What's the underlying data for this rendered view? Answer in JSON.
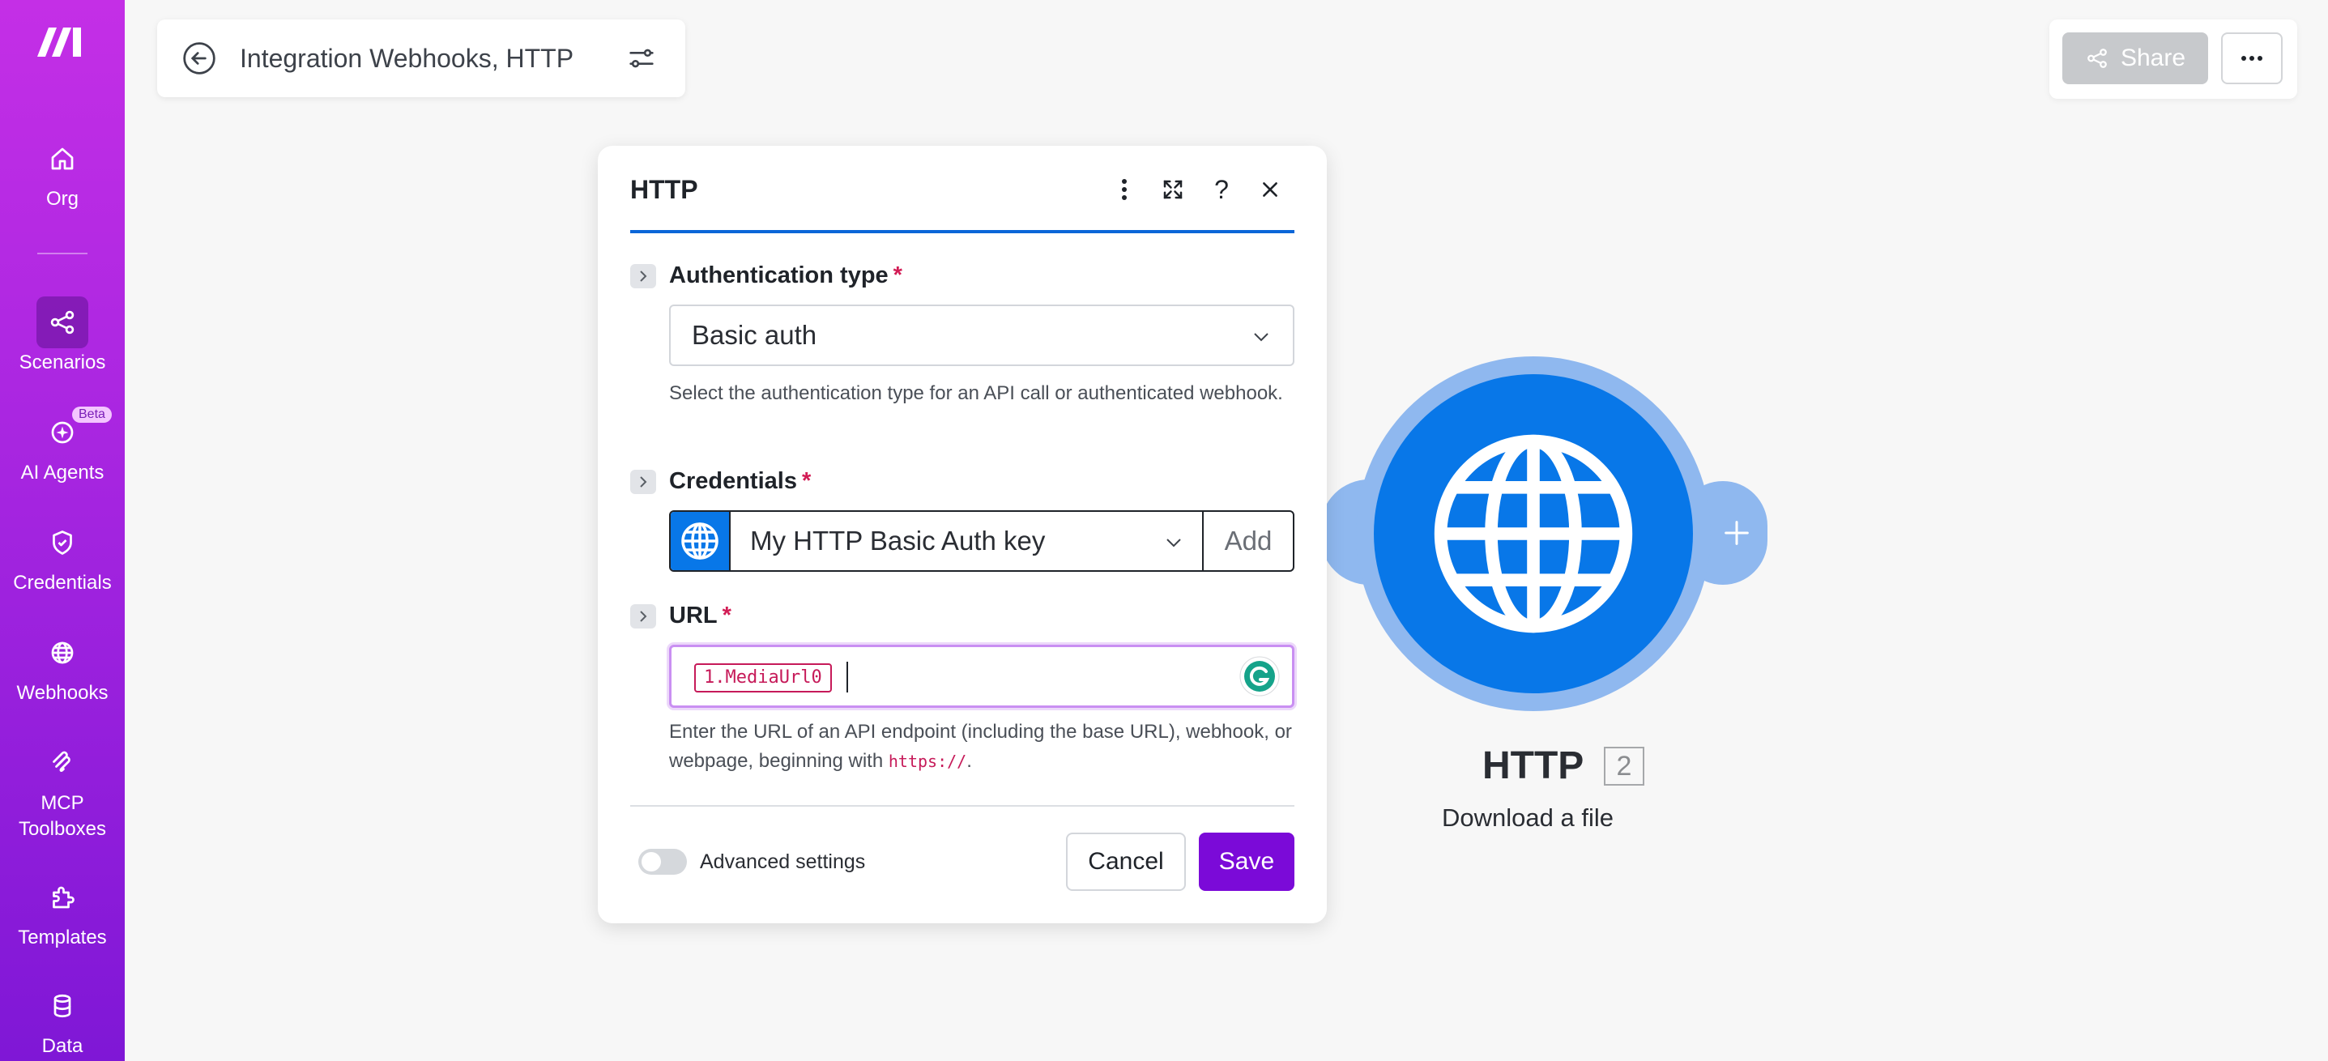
{
  "sidebar": {
    "items": [
      {
        "label": "Org",
        "icon": "home-icon"
      },
      {
        "label": "Scenarios",
        "icon": "share-nodes-icon",
        "active": true
      },
      {
        "label": "AI Agents",
        "icon": "sparkle-icon",
        "badge": "Beta"
      },
      {
        "label": "Credentials",
        "icon": "shield-check-icon"
      },
      {
        "label": "Webhooks",
        "icon": "globe-icon"
      },
      {
        "label": "MCP\nToolboxes",
        "icon": "mcp-icon"
      },
      {
        "label": "Templates",
        "icon": "puzzle-icon"
      },
      {
        "label": "Data",
        "icon": "database-icon"
      }
    ]
  },
  "header": {
    "scenario_title": "Integration Webhooks, HTTP",
    "share_label": "Share"
  },
  "dialog": {
    "title": "HTTP",
    "auth": {
      "label": "Authentication type",
      "required_mark": "*",
      "value": "Basic auth",
      "help": "Select the authentication type for an API call or authenticated webhook."
    },
    "credentials": {
      "label": "Credentials",
      "required_mark": "*",
      "value": "My HTTP Basic Auth key",
      "add_label": "Add"
    },
    "url": {
      "label": "URL",
      "required_mark": "*",
      "pill": "1.MediaUrl0",
      "help_prefix": "Enter the URL of an API endpoint (including the base URL), webhook, or webpage, beginning with ",
      "help_link": "https://",
      "help_suffix": "."
    },
    "advanced_label": "Advanced settings",
    "cancel_label": "Cancel",
    "save_label": "Save"
  },
  "node": {
    "title": "HTTP",
    "badge": "2",
    "subtitle": "Download a file"
  },
  "colors": {
    "sidebar_top": "#c42fe6",
    "sidebar_bottom": "#7f17d6",
    "module_blue": "#0877e8",
    "module_ring": "#8fb8ef",
    "save_purple": "#7b0ad8",
    "required_red": "#d21c55"
  }
}
